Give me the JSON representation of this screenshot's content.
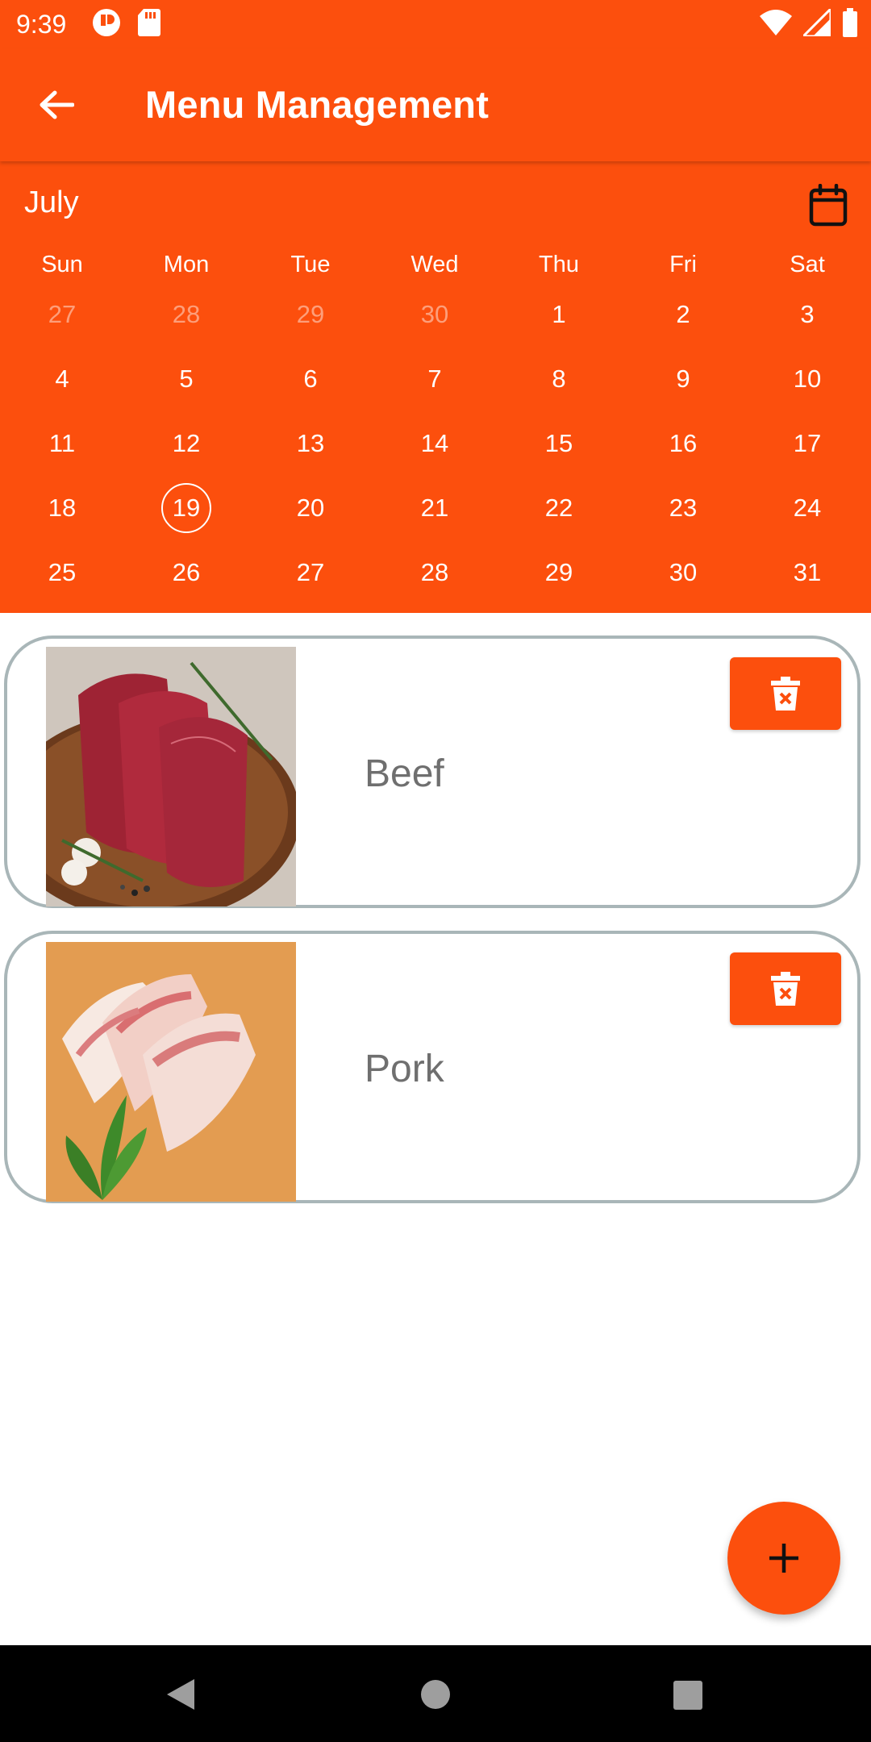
{
  "status_bar": {
    "time": "9:39",
    "left_icons": [
      "notification-app-icon",
      "sd-card-icon"
    ],
    "right_icons": [
      "wifi-icon",
      "cellular-signal-icon",
      "battery-icon"
    ]
  },
  "app_bar": {
    "back_icon": "arrow-left-icon",
    "title": "Menu Management"
  },
  "calendar": {
    "month": "July",
    "icon": "calendar-icon",
    "weekdays": [
      "Sun",
      "Mon",
      "Tue",
      "Wed",
      "Thu",
      "Fri",
      "Sat"
    ],
    "weeks": [
      [
        {
          "day": "27",
          "outside": true
        },
        {
          "day": "28",
          "outside": true
        },
        {
          "day": "29",
          "outside": true
        },
        {
          "day": "30",
          "outside": true
        },
        {
          "day": "1"
        },
        {
          "day": "2"
        },
        {
          "day": "3"
        }
      ],
      [
        {
          "day": "4"
        },
        {
          "day": "5"
        },
        {
          "day": "6"
        },
        {
          "day": "7"
        },
        {
          "day": "8"
        },
        {
          "day": "9"
        },
        {
          "day": "10"
        }
      ],
      [
        {
          "day": "11"
        },
        {
          "day": "12"
        },
        {
          "day": "13"
        },
        {
          "day": "14"
        },
        {
          "day": "15"
        },
        {
          "day": "16"
        },
        {
          "day": "17"
        }
      ],
      [
        {
          "day": "18"
        },
        {
          "day": "19",
          "selected": true
        },
        {
          "day": "20"
        },
        {
          "day": "21"
        },
        {
          "day": "22"
        },
        {
          "day": "23"
        },
        {
          "day": "24"
        }
      ],
      [
        {
          "day": "25"
        },
        {
          "day": "26"
        },
        {
          "day": "27"
        },
        {
          "day": "28"
        },
        {
          "day": "29"
        },
        {
          "day": "30"
        },
        {
          "day": "31"
        }
      ]
    ]
  },
  "menu_items": [
    {
      "name": "Beef",
      "image": "raw-beef-photo",
      "delete_icon": "trash-icon"
    },
    {
      "name": "Pork",
      "image": "raw-pork-belly-photo",
      "delete_icon": "trash-icon"
    }
  ],
  "fab": {
    "icon": "plus-icon"
  },
  "nav_bar": {
    "icons": [
      "back-triangle-icon",
      "home-circle-icon",
      "recents-square-icon"
    ]
  },
  "colors": {
    "accent": "#fc4f0d",
    "card_border": "#a9b6b8",
    "item_text": "#6f6f6f",
    "nav_bar": "#000000"
  }
}
